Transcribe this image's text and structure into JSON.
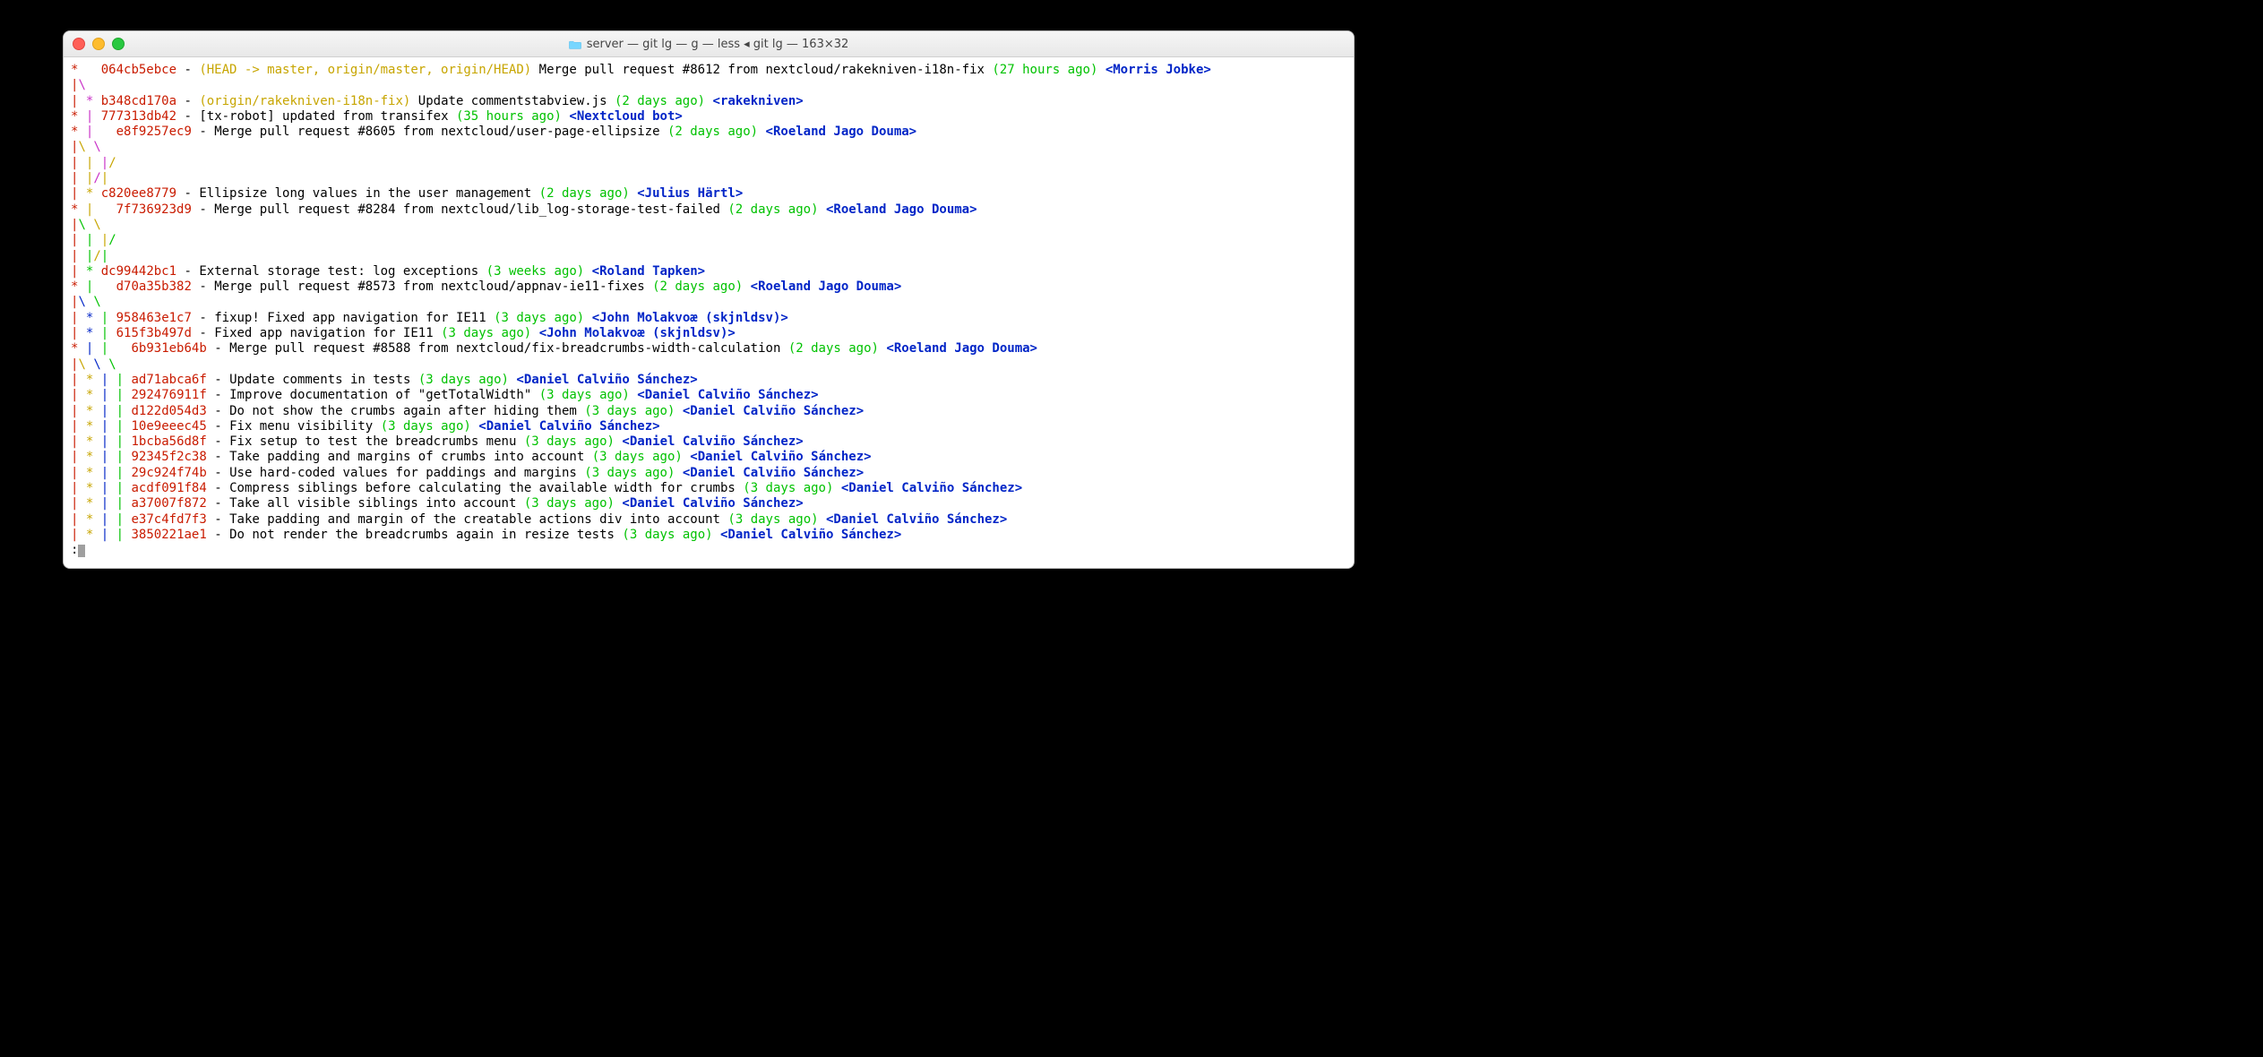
{
  "window": {
    "title": "server — git lg — g — less ◂ git lg — 163×32"
  },
  "prompt": ":",
  "colors": {
    "red": "#c91b00",
    "yellow": "#c7a500",
    "green": "#00c200",
    "blue": "#0225c7",
    "magenta": "#c930c7",
    "cyan": "#00c5c7"
  },
  "lines": [
    {
      "type": "commit",
      "graph": [
        {
          "t": "*",
          "c": "red"
        },
        {
          "t": "   ",
          "c": null
        }
      ],
      "hash": "064cb5ebce",
      "refs": "(HEAD -> master, origin/master, origin/HEAD)",
      "msg": "Merge pull request #8612 from nextcloud/rakekniven-i18n-fix",
      "age": "(27 hours ago)",
      "author": "<Morris Jobke>"
    },
    {
      "type": "graph",
      "graph": [
        {
          "t": "|",
          "c": "red"
        },
        {
          "t": "\\",
          "c": "magenta"
        }
      ]
    },
    {
      "type": "commit",
      "graph": [
        {
          "t": "|",
          "c": "red"
        },
        {
          "t": " ",
          "c": null
        },
        {
          "t": "*",
          "c": "magenta"
        },
        {
          "t": " ",
          "c": null
        }
      ],
      "hash": "b348cd170a",
      "refs": "(origin/rakekniven-i18n-fix)",
      "msg": "Update commentstabview.js",
      "age": "(2 days ago)",
      "author": "<rakekniven>"
    },
    {
      "type": "commit",
      "graph": [
        {
          "t": "*",
          "c": "red"
        },
        {
          "t": " ",
          "c": null
        },
        {
          "t": "|",
          "c": "magenta"
        },
        {
          "t": " ",
          "c": null
        }
      ],
      "hash": "777313db42",
      "refs": null,
      "msg": "[tx-robot] updated from transifex",
      "age": "(35 hours ago)",
      "author": "<Nextcloud bot>"
    },
    {
      "type": "commit",
      "graph": [
        {
          "t": "*",
          "c": "red"
        },
        {
          "t": " ",
          "c": null
        },
        {
          "t": "|",
          "c": "magenta"
        },
        {
          "t": "   ",
          "c": null
        }
      ],
      "hash": "e8f9257ec9",
      "refs": null,
      "msg": "Merge pull request #8605 from nextcloud/user-page-ellipsize",
      "age": "(2 days ago)",
      "author": "<Roeland Jago Douma>"
    },
    {
      "type": "graph",
      "graph": [
        {
          "t": "|",
          "c": "red"
        },
        {
          "t": "\\",
          "c": "yellow"
        },
        {
          "t": " ",
          "c": null
        },
        {
          "t": "\\",
          "c": "magenta"
        }
      ]
    },
    {
      "type": "graph",
      "graph": [
        {
          "t": "|",
          "c": "red"
        },
        {
          "t": " ",
          "c": null
        },
        {
          "t": "|",
          "c": "yellow"
        },
        {
          "t": " ",
          "c": null
        },
        {
          "t": "|",
          "c": "magenta"
        },
        {
          "t": "/",
          "c": "yellow"
        }
      ]
    },
    {
      "type": "graph",
      "graph": [
        {
          "t": "|",
          "c": "red"
        },
        {
          "t": " ",
          "c": null
        },
        {
          "t": "|",
          "c": "yellow"
        },
        {
          "t": "/",
          "c": "magenta"
        },
        {
          "t": "|",
          "c": "yellow"
        }
      ]
    },
    {
      "type": "commit",
      "graph": [
        {
          "t": "|",
          "c": "red"
        },
        {
          "t": " ",
          "c": null
        },
        {
          "t": "*",
          "c": "yellow"
        },
        {
          "t": " ",
          "c": null
        }
      ],
      "hash": "c820ee8779",
      "refs": null,
      "msg": "Ellipsize long values in the user management",
      "age": "(2 days ago)",
      "author": "<Julius Härtl>"
    },
    {
      "type": "commit",
      "graph": [
        {
          "t": "*",
          "c": "red"
        },
        {
          "t": " ",
          "c": null
        },
        {
          "t": "|",
          "c": "yellow"
        },
        {
          "t": "   ",
          "c": null
        }
      ],
      "hash": "7f736923d9",
      "refs": null,
      "msg": "Merge pull request #8284 from nextcloud/lib_log-storage-test-failed",
      "age": "(2 days ago)",
      "author": "<Roeland Jago Douma>"
    },
    {
      "type": "graph",
      "graph": [
        {
          "t": "|",
          "c": "red"
        },
        {
          "t": "\\",
          "c": "green"
        },
        {
          "t": " ",
          "c": null
        },
        {
          "t": "\\",
          "c": "yellow"
        }
      ]
    },
    {
      "type": "graph",
      "graph": [
        {
          "t": "|",
          "c": "red"
        },
        {
          "t": " ",
          "c": null
        },
        {
          "t": "|",
          "c": "green"
        },
        {
          "t": " ",
          "c": null
        },
        {
          "t": "|",
          "c": "yellow"
        },
        {
          "t": "/",
          "c": "green"
        }
      ]
    },
    {
      "type": "graph",
      "graph": [
        {
          "t": "|",
          "c": "red"
        },
        {
          "t": " ",
          "c": null
        },
        {
          "t": "|",
          "c": "green"
        },
        {
          "t": "/",
          "c": "yellow"
        },
        {
          "t": "|",
          "c": "green"
        }
      ]
    },
    {
      "type": "commit",
      "graph": [
        {
          "t": "|",
          "c": "red"
        },
        {
          "t": " ",
          "c": null
        },
        {
          "t": "*",
          "c": "green"
        },
        {
          "t": " ",
          "c": null
        }
      ],
      "hash": "dc99442bc1",
      "refs": null,
      "msg": "External storage test: log exceptions",
      "age": "(3 weeks ago)",
      "author": "<Roland Tapken>"
    },
    {
      "type": "commit",
      "graph": [
        {
          "t": "*",
          "c": "red"
        },
        {
          "t": " ",
          "c": null
        },
        {
          "t": "|",
          "c": "green"
        },
        {
          "t": "   ",
          "c": null
        }
      ],
      "hash": "d70a35b382",
      "refs": null,
      "msg": "Merge pull request #8573 from nextcloud/appnav-ie11-fixes",
      "age": "(2 days ago)",
      "author": "<Roeland Jago Douma>"
    },
    {
      "type": "graph",
      "graph": [
        {
          "t": "|",
          "c": "red"
        },
        {
          "t": "\\",
          "c": "blue"
        },
        {
          "t": " ",
          "c": null
        },
        {
          "t": "\\",
          "c": "green"
        }
      ]
    },
    {
      "type": "commit",
      "graph": [
        {
          "t": "|",
          "c": "red"
        },
        {
          "t": " ",
          "c": null
        },
        {
          "t": "*",
          "c": "blue"
        },
        {
          "t": " ",
          "c": null
        },
        {
          "t": "|",
          "c": "green"
        },
        {
          "t": " ",
          "c": null
        }
      ],
      "hash": "958463e1c7",
      "refs": null,
      "msg": "fixup! Fixed app navigation for IE11",
      "age": "(3 days ago)",
      "author": "<John Molakvoæ (skjnldsv)>"
    },
    {
      "type": "commit",
      "graph": [
        {
          "t": "|",
          "c": "red"
        },
        {
          "t": " ",
          "c": null
        },
        {
          "t": "*",
          "c": "blue"
        },
        {
          "t": " ",
          "c": null
        },
        {
          "t": "|",
          "c": "green"
        },
        {
          "t": " ",
          "c": null
        }
      ],
      "hash": "615f3b497d",
      "refs": null,
      "msg": "Fixed app navigation for IE11",
      "age": "(3 days ago)",
      "author": "<John Molakvoæ (skjnldsv)>"
    },
    {
      "type": "commit",
      "graph": [
        {
          "t": "*",
          "c": "red"
        },
        {
          "t": " ",
          "c": null
        },
        {
          "t": "|",
          "c": "blue"
        },
        {
          "t": " ",
          "c": null
        },
        {
          "t": "|",
          "c": "green"
        },
        {
          "t": "   ",
          "c": null
        }
      ],
      "hash": "6b931eb64b",
      "refs": null,
      "msg": "Merge pull request #8588 from nextcloud/fix-breadcrumbs-width-calculation",
      "age": "(2 days ago)",
      "author": "<Roeland Jago Douma>"
    },
    {
      "type": "graph",
      "graph": [
        {
          "t": "|",
          "c": "red"
        },
        {
          "t": "\\",
          "c": "yellow"
        },
        {
          "t": " ",
          "c": null
        },
        {
          "t": "\\",
          "c": "blue"
        },
        {
          "t": " ",
          "c": null
        },
        {
          "t": "\\",
          "c": "green"
        }
      ]
    },
    {
      "type": "commit",
      "graph": [
        {
          "t": "|",
          "c": "red"
        },
        {
          "t": " ",
          "c": null
        },
        {
          "t": "*",
          "c": "yellow"
        },
        {
          "t": " ",
          "c": null
        },
        {
          "t": "|",
          "c": "blue"
        },
        {
          "t": " ",
          "c": null
        },
        {
          "t": "|",
          "c": "green"
        },
        {
          "t": " ",
          "c": null
        }
      ],
      "hash": "ad71abca6f",
      "refs": null,
      "msg": "Update comments in tests",
      "age": "(3 days ago)",
      "author": "<Daniel Calviño Sánchez>"
    },
    {
      "type": "commit",
      "graph": [
        {
          "t": "|",
          "c": "red"
        },
        {
          "t": " ",
          "c": null
        },
        {
          "t": "*",
          "c": "yellow"
        },
        {
          "t": " ",
          "c": null
        },
        {
          "t": "|",
          "c": "blue"
        },
        {
          "t": " ",
          "c": null
        },
        {
          "t": "|",
          "c": "green"
        },
        {
          "t": " ",
          "c": null
        }
      ],
      "hash": "292476911f",
      "refs": null,
      "msg": "Improve documentation of \"getTotalWidth\"",
      "age": "(3 days ago)",
      "author": "<Daniel Calviño Sánchez>"
    },
    {
      "type": "commit",
      "graph": [
        {
          "t": "|",
          "c": "red"
        },
        {
          "t": " ",
          "c": null
        },
        {
          "t": "*",
          "c": "yellow"
        },
        {
          "t": " ",
          "c": null
        },
        {
          "t": "|",
          "c": "blue"
        },
        {
          "t": " ",
          "c": null
        },
        {
          "t": "|",
          "c": "green"
        },
        {
          "t": " ",
          "c": null
        }
      ],
      "hash": "d122d054d3",
      "refs": null,
      "msg": "Do not show the crumbs again after hiding them",
      "age": "(3 days ago)",
      "author": "<Daniel Calviño Sánchez>"
    },
    {
      "type": "commit",
      "graph": [
        {
          "t": "|",
          "c": "red"
        },
        {
          "t": " ",
          "c": null
        },
        {
          "t": "*",
          "c": "yellow"
        },
        {
          "t": " ",
          "c": null
        },
        {
          "t": "|",
          "c": "blue"
        },
        {
          "t": " ",
          "c": null
        },
        {
          "t": "|",
          "c": "green"
        },
        {
          "t": " ",
          "c": null
        }
      ],
      "hash": "10e9eeec45",
      "refs": null,
      "msg": "Fix menu visibility",
      "age": "(3 days ago)",
      "author": "<Daniel Calviño Sánchez>"
    },
    {
      "type": "commit",
      "graph": [
        {
          "t": "|",
          "c": "red"
        },
        {
          "t": " ",
          "c": null
        },
        {
          "t": "*",
          "c": "yellow"
        },
        {
          "t": " ",
          "c": null
        },
        {
          "t": "|",
          "c": "blue"
        },
        {
          "t": " ",
          "c": null
        },
        {
          "t": "|",
          "c": "green"
        },
        {
          "t": " ",
          "c": null
        }
      ],
      "hash": "1bcba56d8f",
      "refs": null,
      "msg": "Fix setup to test the breadcrumbs menu",
      "age": "(3 days ago)",
      "author": "<Daniel Calviño Sánchez>"
    },
    {
      "type": "commit",
      "graph": [
        {
          "t": "|",
          "c": "red"
        },
        {
          "t": " ",
          "c": null
        },
        {
          "t": "*",
          "c": "yellow"
        },
        {
          "t": " ",
          "c": null
        },
        {
          "t": "|",
          "c": "blue"
        },
        {
          "t": " ",
          "c": null
        },
        {
          "t": "|",
          "c": "green"
        },
        {
          "t": " ",
          "c": null
        }
      ],
      "hash": "92345f2c38",
      "refs": null,
      "msg": "Take padding and margins of crumbs into account",
      "age": "(3 days ago)",
      "author": "<Daniel Calviño Sánchez>"
    },
    {
      "type": "commit",
      "graph": [
        {
          "t": "|",
          "c": "red"
        },
        {
          "t": " ",
          "c": null
        },
        {
          "t": "*",
          "c": "yellow"
        },
        {
          "t": " ",
          "c": null
        },
        {
          "t": "|",
          "c": "blue"
        },
        {
          "t": " ",
          "c": null
        },
        {
          "t": "|",
          "c": "green"
        },
        {
          "t": " ",
          "c": null
        }
      ],
      "hash": "29c924f74b",
      "refs": null,
      "msg": "Use hard-coded values for paddings and margins",
      "age": "(3 days ago)",
      "author": "<Daniel Calviño Sánchez>"
    },
    {
      "type": "commit",
      "graph": [
        {
          "t": "|",
          "c": "red"
        },
        {
          "t": " ",
          "c": null
        },
        {
          "t": "*",
          "c": "yellow"
        },
        {
          "t": " ",
          "c": null
        },
        {
          "t": "|",
          "c": "blue"
        },
        {
          "t": " ",
          "c": null
        },
        {
          "t": "|",
          "c": "green"
        },
        {
          "t": " ",
          "c": null
        }
      ],
      "hash": "acdf091f84",
      "refs": null,
      "msg": "Compress siblings before calculating the available width for crumbs",
      "age": "(3 days ago)",
      "author": "<Daniel Calviño Sánchez>"
    },
    {
      "type": "commit",
      "graph": [
        {
          "t": "|",
          "c": "red"
        },
        {
          "t": " ",
          "c": null
        },
        {
          "t": "*",
          "c": "yellow"
        },
        {
          "t": " ",
          "c": null
        },
        {
          "t": "|",
          "c": "blue"
        },
        {
          "t": " ",
          "c": null
        },
        {
          "t": "|",
          "c": "green"
        },
        {
          "t": " ",
          "c": null
        }
      ],
      "hash": "a37007f872",
      "refs": null,
      "msg": "Take all visible siblings into account",
      "age": "(3 days ago)",
      "author": "<Daniel Calviño Sánchez>"
    },
    {
      "type": "commit",
      "graph": [
        {
          "t": "|",
          "c": "red"
        },
        {
          "t": " ",
          "c": null
        },
        {
          "t": "*",
          "c": "yellow"
        },
        {
          "t": " ",
          "c": null
        },
        {
          "t": "|",
          "c": "blue"
        },
        {
          "t": " ",
          "c": null
        },
        {
          "t": "|",
          "c": "green"
        },
        {
          "t": " ",
          "c": null
        }
      ],
      "hash": "e37c4fd7f3",
      "refs": null,
      "msg": "Take padding and margin of the creatable actions div into account",
      "age": "(3 days ago)",
      "author": "<Daniel Calviño Sánchez>"
    },
    {
      "type": "commit",
      "graph": [
        {
          "t": "|",
          "c": "red"
        },
        {
          "t": " ",
          "c": null
        },
        {
          "t": "*",
          "c": "yellow"
        },
        {
          "t": " ",
          "c": null
        },
        {
          "t": "|",
          "c": "blue"
        },
        {
          "t": " ",
          "c": null
        },
        {
          "t": "|",
          "c": "green"
        },
        {
          "t": " ",
          "c": null
        }
      ],
      "hash": "3850221ae1",
      "refs": null,
      "msg": "Do not render the breadcrumbs again in resize tests",
      "age": "(3 days ago)",
      "author": "<Daniel Calviño Sánchez>"
    }
  ]
}
